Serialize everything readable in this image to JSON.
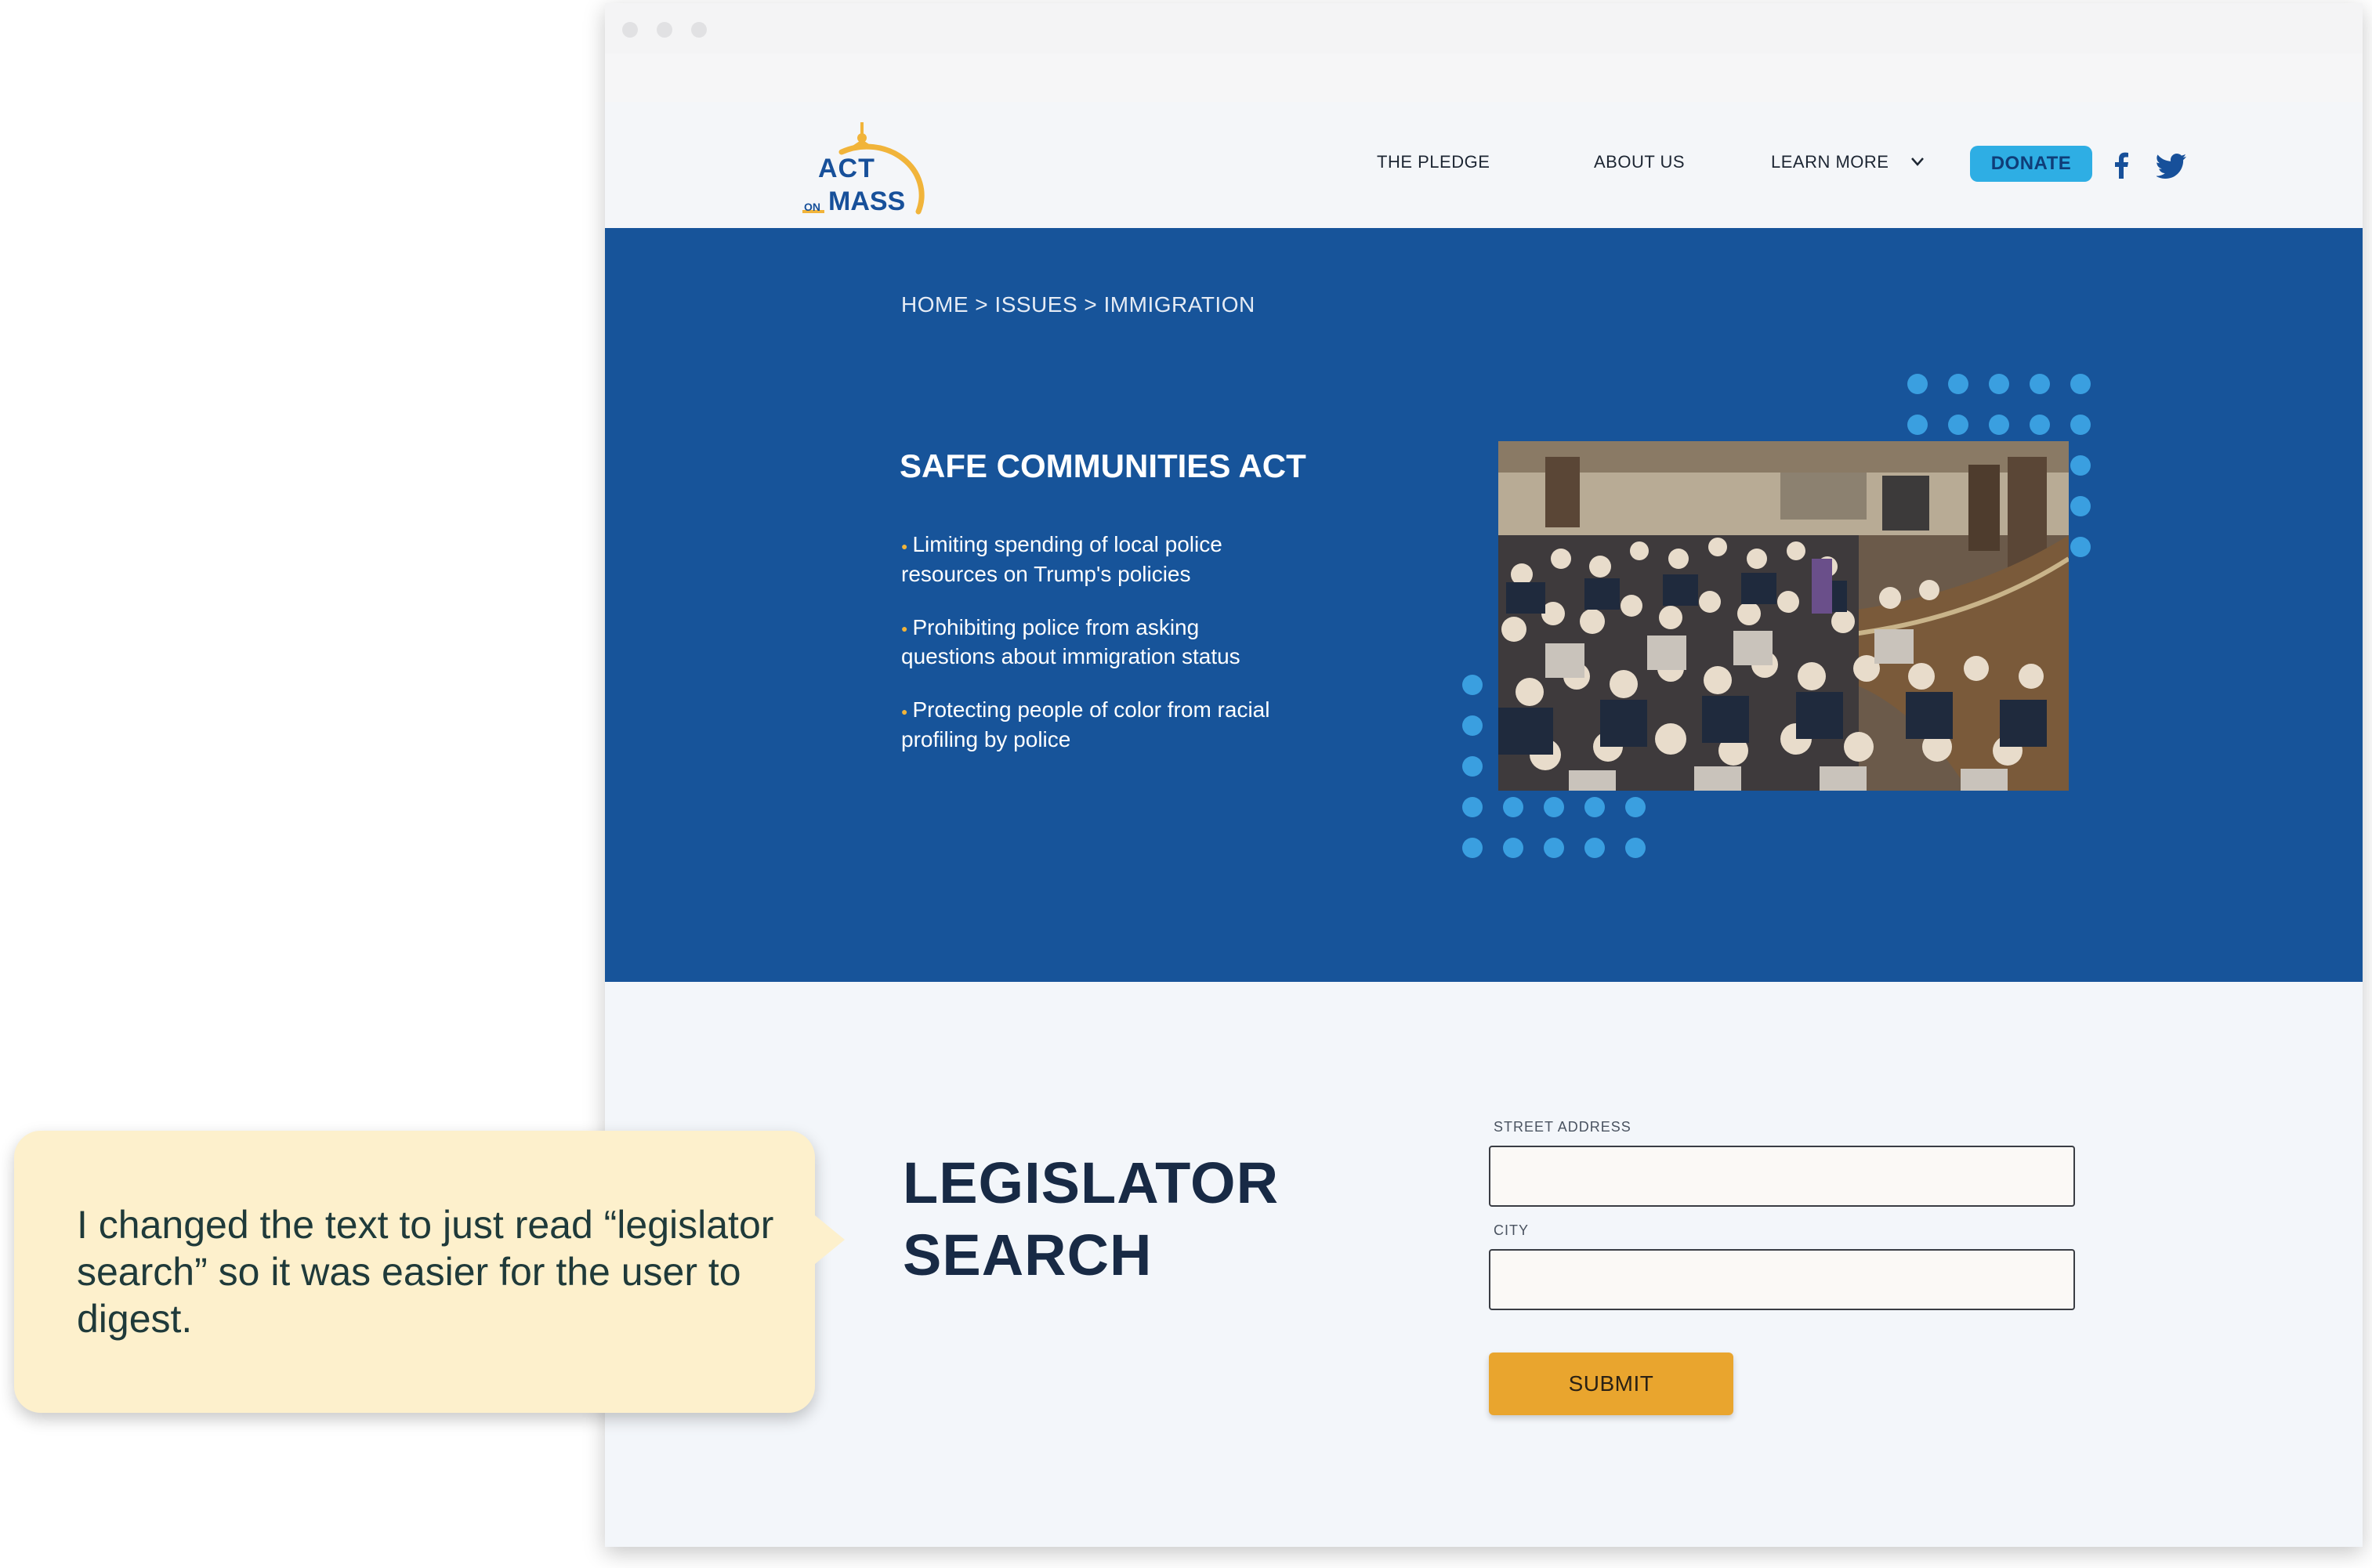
{
  "header": {
    "logo": {
      "line1": "ACT",
      "line2_small": "ON",
      "line2": "MASS"
    },
    "nav": [
      "THE PLEDGE",
      "ABOUT US",
      "LEARN MORE"
    ],
    "donate_label": "DONATE"
  },
  "hero": {
    "breadcrumb": "HOME > ISSUES > IMMIGRATION",
    "title": "SAFE COMMUNITIES ACT",
    "bullets": [
      "Limiting spending of local police resources on Trump's policies",
      "Prohibiting police from asking questions about immigration status",
      "Protecting people of color from racial profiling by police"
    ]
  },
  "search": {
    "title_line1": "LEGISLATOR",
    "title_line2": "SEARCH",
    "field1_label": "STREET ADDRESS",
    "field2_label": "CITY",
    "field1_value": "",
    "field2_value": "",
    "submit_label": "SUBMIT"
  },
  "annotation": {
    "text": "I changed the text to just read “legislator search” so it was easier for the user to digest."
  },
  "icons": [
    "chevron-down-icon",
    "facebook-icon",
    "twitter-icon"
  ],
  "colors": {
    "brand_blue": "#17549a",
    "donate": "#2eaee4",
    "submit": "#e9a52e",
    "accent_gold": "#f1b43a",
    "callout_bg": "#fdf0cc",
    "dots": "#3a9fe0"
  }
}
